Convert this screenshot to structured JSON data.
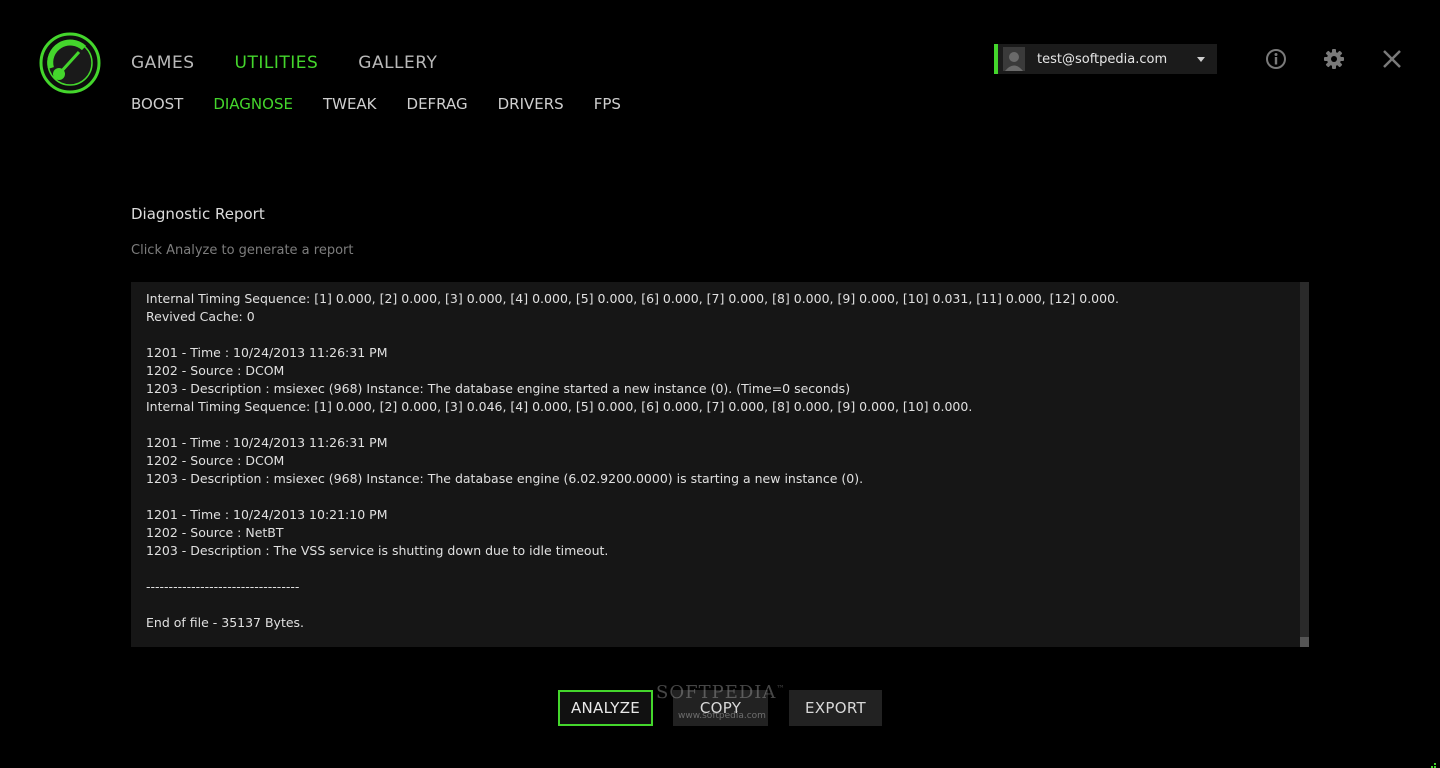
{
  "brand": {
    "accent": "#44d62c",
    "logo_icon": "speedometer-icon"
  },
  "top_nav": [
    {
      "label": "GAMES",
      "active": false
    },
    {
      "label": "UTILITIES",
      "active": true
    },
    {
      "label": "GALLERY",
      "active": false
    }
  ],
  "sub_nav": [
    {
      "label": "BOOST",
      "active": false
    },
    {
      "label": "DIAGNOSE",
      "active": true
    },
    {
      "label": "TWEAK",
      "active": false
    },
    {
      "label": "DEFRAG",
      "active": false
    },
    {
      "label": "DRIVERS",
      "active": false
    },
    {
      "label": "FPS",
      "active": false
    }
  ],
  "account": {
    "email": "test@softpedia.com"
  },
  "window_controls": {
    "info": "info-icon",
    "settings": "gear-icon",
    "close": "close-icon"
  },
  "report": {
    "title": "Diagnostic Report",
    "hint": "Click Analyze to generate a report",
    "lines": [
      "Internal Timing Sequence: [1] 0.000, [2] 0.000, [3] 0.000, [4] 0.000, [5] 0.000, [6] 0.000, [7] 0.000, [8] 0.000, [9] 0.000, [10] 0.031, [11] 0.000, [12] 0.000.",
      "Revived Cache: 0",
      "",
      "1201 - Time : 10/24/2013 11:26:31 PM",
      "1202 - Source : DCOM",
      "1203 - Description : msiexec (968) Instance: The database engine started a new instance (0). (Time=0 seconds)",
      "Internal Timing Sequence: [1] 0.000, [2] 0.000, [3] 0.046, [4] 0.000, [5] 0.000, [6] 0.000, [7] 0.000, [8] 0.000, [9] 0.000, [10] 0.000.",
      "",
      "1201 - Time : 10/24/2013 11:26:31 PM",
      "1202 - Source : DCOM",
      "1203 - Description : msiexec (968) Instance: The database engine (6.02.9200.0000) is starting a new instance (0).",
      "",
      "1201 - Time : 10/24/2013 10:21:10 PM",
      "1202 - Source : NetBT",
      "1203 - Description : The VSS service is shutting down due to idle timeout.",
      "",
      "----------------------------------",
      "",
      "End of file - 35137 Bytes."
    ],
    "scroll_position": 1.0
  },
  "buttons": {
    "analyze": "ANALYZE",
    "copy": "COPY",
    "export": "EXPORT"
  },
  "watermark": {
    "brand": "SOFTPEDIA",
    "tm": "™",
    "url": "www.softpedia.com"
  }
}
